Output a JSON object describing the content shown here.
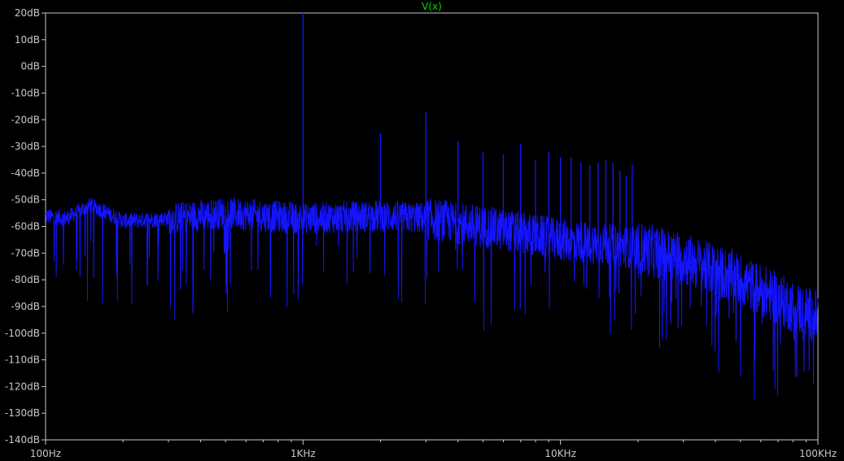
{
  "chart_data": {
    "type": "line",
    "title": "V(x)",
    "x_scale": "log",
    "xlim": [
      100,
      100000
    ],
    "ylim": [
      -140,
      20
    ],
    "x_tick_values": [
      100,
      1000,
      10000,
      100000
    ],
    "x_tick_labels": [
      "100Hz",
      "1KHz",
      "10KHz",
      "100KHz"
    ],
    "y_tick_values": [
      20,
      10,
      0,
      -10,
      -20,
      -30,
      -40,
      -50,
      -60,
      -70,
      -80,
      -90,
      -100,
      -110,
      -120,
      -130,
      -140
    ],
    "y_tick_labels": [
      "20dB",
      "10dB",
      "0dB",
      "-10dB",
      "-20dB",
      "-30dB",
      "-40dB",
      "-50dB",
      "-60dB",
      "-70dB",
      "-80dB",
      "-90dB",
      "-100dB",
      "-110dB",
      "-120dB",
      "-130dB",
      "-140dB"
    ],
    "grid": false,
    "series": [
      {
        "name": "V(x)",
        "color": "#1414ff",
        "noise_floor": [
          {
            "x": 100,
            "y": -56
          },
          {
            "x": 120,
            "y": -57
          },
          {
            "x": 150,
            "y": -52
          },
          {
            "x": 200,
            "y": -58
          },
          {
            "x": 300,
            "y": -57
          },
          {
            "x": 500,
            "y": -55
          },
          {
            "x": 1000,
            "y": -57
          },
          {
            "x": 2000,
            "y": -56
          },
          {
            "x": 3000,
            "y": -57
          },
          {
            "x": 5000,
            "y": -60
          },
          {
            "x": 10000,
            "y": -65
          },
          {
            "x": 20000,
            "y": -68
          },
          {
            "x": 30000,
            "y": -72
          },
          {
            "x": 50000,
            "y": -80
          },
          {
            "x": 80000,
            "y": -90
          },
          {
            "x": 100000,
            "y": -94
          }
        ],
        "harmonic_peaks": [
          {
            "x": 1000,
            "y": 20
          },
          {
            "x": 2000,
            "y": -25
          },
          {
            "x": 3000,
            "y": -17
          },
          {
            "x": 4000,
            "y": -28
          },
          {
            "x": 5000,
            "y": -32
          },
          {
            "x": 6000,
            "y": -33
          },
          {
            "x": 7000,
            "y": -29
          },
          {
            "x": 8000,
            "y": -35
          },
          {
            "x": 9000,
            "y": -32
          },
          {
            "x": 10000,
            "y": -34
          },
          {
            "x": 11000,
            "y": -34
          },
          {
            "x": 12000,
            "y": -36
          },
          {
            "x": 13000,
            "y": -37
          },
          {
            "x": 14000,
            "y": -36
          },
          {
            "x": 15000,
            "y": -35
          },
          {
            "x": 16000,
            "y": -36
          },
          {
            "x": 17000,
            "y": -39
          },
          {
            "x": 18000,
            "y": -41
          },
          {
            "x": 19000,
            "y": -37
          }
        ]
      }
    ]
  }
}
